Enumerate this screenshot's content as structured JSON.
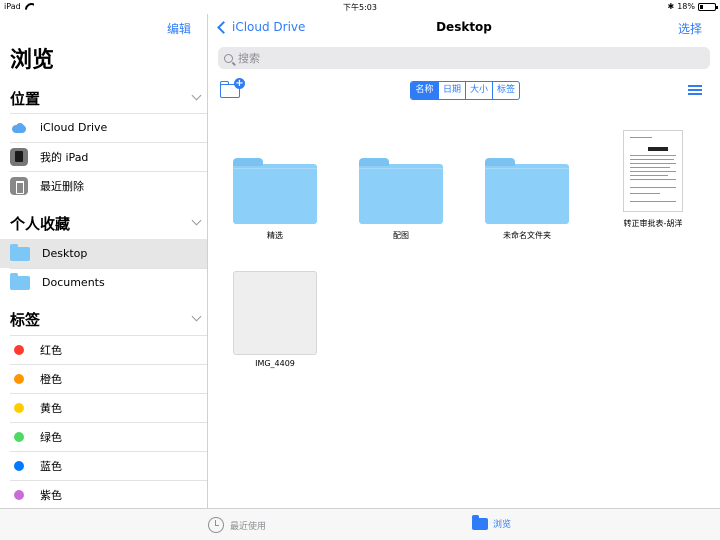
{
  "status": {
    "device": "iPad",
    "time": "下午5:03",
    "battery": "18%",
    "battery_level": 0.18
  },
  "sidebar": {
    "edit": "编辑",
    "title": "浏览",
    "locations": {
      "header": "位置",
      "items": [
        {
          "label": "iCloud Drive",
          "icon": "icloud-icon"
        },
        {
          "label": "我的 iPad",
          "icon": "ipad-icon"
        },
        {
          "label": "最近删除",
          "icon": "trash-icon"
        }
      ]
    },
    "favorites": {
      "header": "个人收藏",
      "items": [
        {
          "label": "Desktop",
          "icon": "folder-icon",
          "selected": true
        },
        {
          "label": "Documents",
          "icon": "folder-icon"
        }
      ]
    },
    "tags": {
      "header": "标签",
      "items": [
        {
          "label": "红色",
          "color": "#ff3b30"
        },
        {
          "label": "橙色",
          "color": "#ff9500"
        },
        {
          "label": "黄色",
          "color": "#ffcc00"
        },
        {
          "label": "绿色",
          "color": "#4cd964"
        },
        {
          "label": "蓝色",
          "color": "#007aff"
        },
        {
          "label": "紫色",
          "color": "#c86dd7"
        }
      ]
    }
  },
  "main": {
    "back": "iCloud Drive",
    "title": "Desktop",
    "select": "选择",
    "search_placeholder": "搜索",
    "sort": [
      "名称",
      "日期",
      "大小",
      "标签"
    ],
    "items": [
      {
        "label": "精选",
        "type": "folder"
      },
      {
        "label": "配图",
        "type": "folder"
      },
      {
        "label": "未命名文件夹",
        "type": "folder"
      },
      {
        "label": "转正审批表-胡洋",
        "type": "document"
      },
      {
        "label": "IMG_4409",
        "type": "image"
      }
    ]
  },
  "tabbar": {
    "recents": "最近使用",
    "browse": "浏览"
  },
  "colors": {
    "accent": "#2f7cf6",
    "folder": "#8ccff8"
  }
}
